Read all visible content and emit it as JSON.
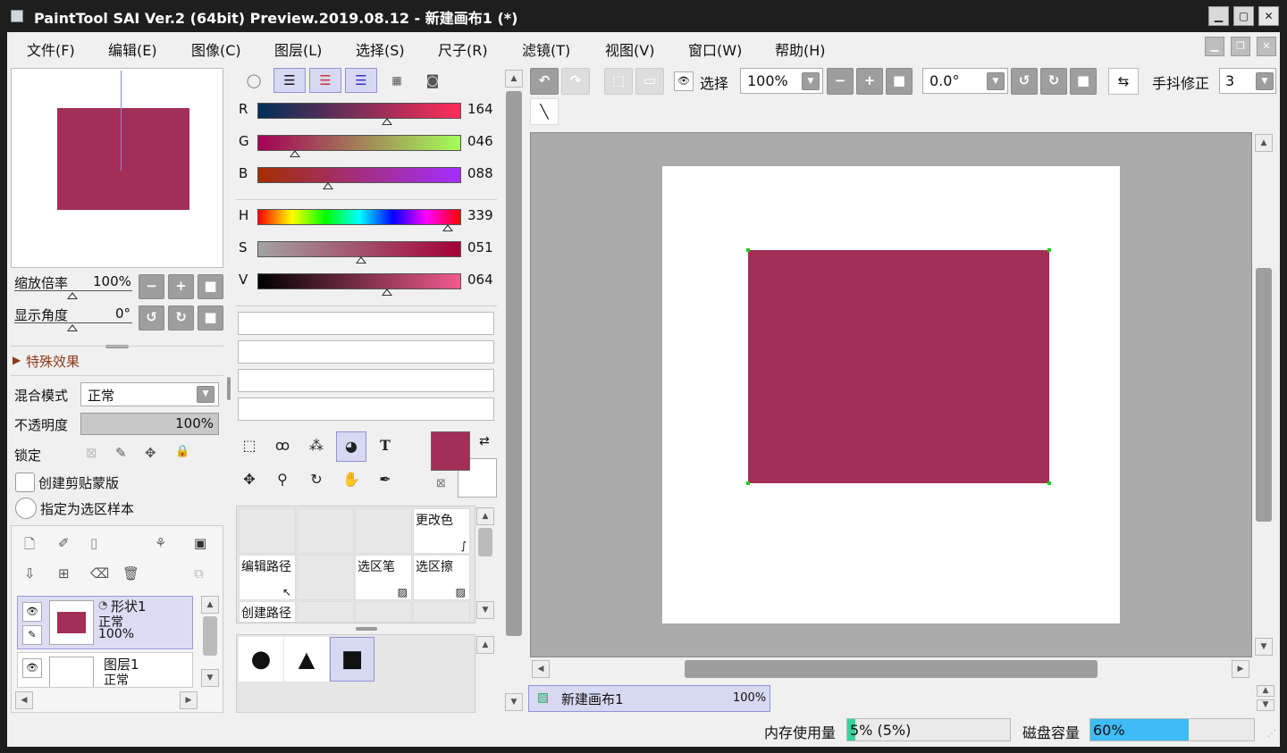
{
  "window": {
    "title": "PaintTool SAI Ver.2 (64bit) Preview.2019.08.12 - 新建画布1 (*)"
  },
  "menu": [
    "文件(F)",
    "编辑(E)",
    "图像(C)",
    "图层(L)",
    "选择(S)",
    "尺子(R)",
    "滤镜(T)",
    "视图(V)",
    "窗口(W)",
    "帮助(H)"
  ],
  "navigator": {
    "zoom_label": "缩放倍率",
    "zoom_value": "100%",
    "angle_label": "显示角度",
    "angle_value": "0°"
  },
  "effects": {
    "label": "特殊效果"
  },
  "layer_props": {
    "blend_label": "混合模式",
    "blend_value": "正常",
    "opacity_label": "不透明度",
    "opacity_value": "100%",
    "lock_label": "锁定",
    "clip_label": "创建剪贴蒙版",
    "sample_label": "指定为选区样本"
  },
  "layers": [
    {
      "name": "形状1",
      "mode": "正常",
      "opacity": "100%"
    },
    {
      "name": "图层1",
      "mode": "正常"
    }
  ],
  "color": {
    "swatch": "#a32e58",
    "rgb": [
      {
        "ch": "R",
        "val": "164"
      },
      {
        "ch": "G",
        "val": "046"
      },
      {
        "ch": "B",
        "val": "088"
      }
    ],
    "hsv": [
      {
        "ch": "H",
        "val": "339"
      },
      {
        "ch": "S",
        "val": "051"
      },
      {
        "ch": "V",
        "val": "064"
      }
    ]
  },
  "toolbox": {
    "cells": [
      "更改色",
      "编辑路径",
      "选区笔",
      "选区擦",
      "创建路径"
    ]
  },
  "canvas_toolbar": {
    "select_label": "选择",
    "zoom_value": "100%",
    "angle_value": "0.0°",
    "stabilizer_label": "手抖修正",
    "stabilizer_value": "3"
  },
  "doc_tab": {
    "name": "新建画布1",
    "zoom": "100%"
  },
  "status": {
    "mem_label": "内存使用量",
    "mem_value": "5% (5%)",
    "mem_fraction": 0.05,
    "disk_label": "磁盘容量",
    "disk_value": "60%",
    "disk_fraction": 0.6
  },
  "colors": {
    "accent": "#a32e58",
    "disk_bar": "#3fbcf5",
    "mem_bar": "#36d39a"
  }
}
